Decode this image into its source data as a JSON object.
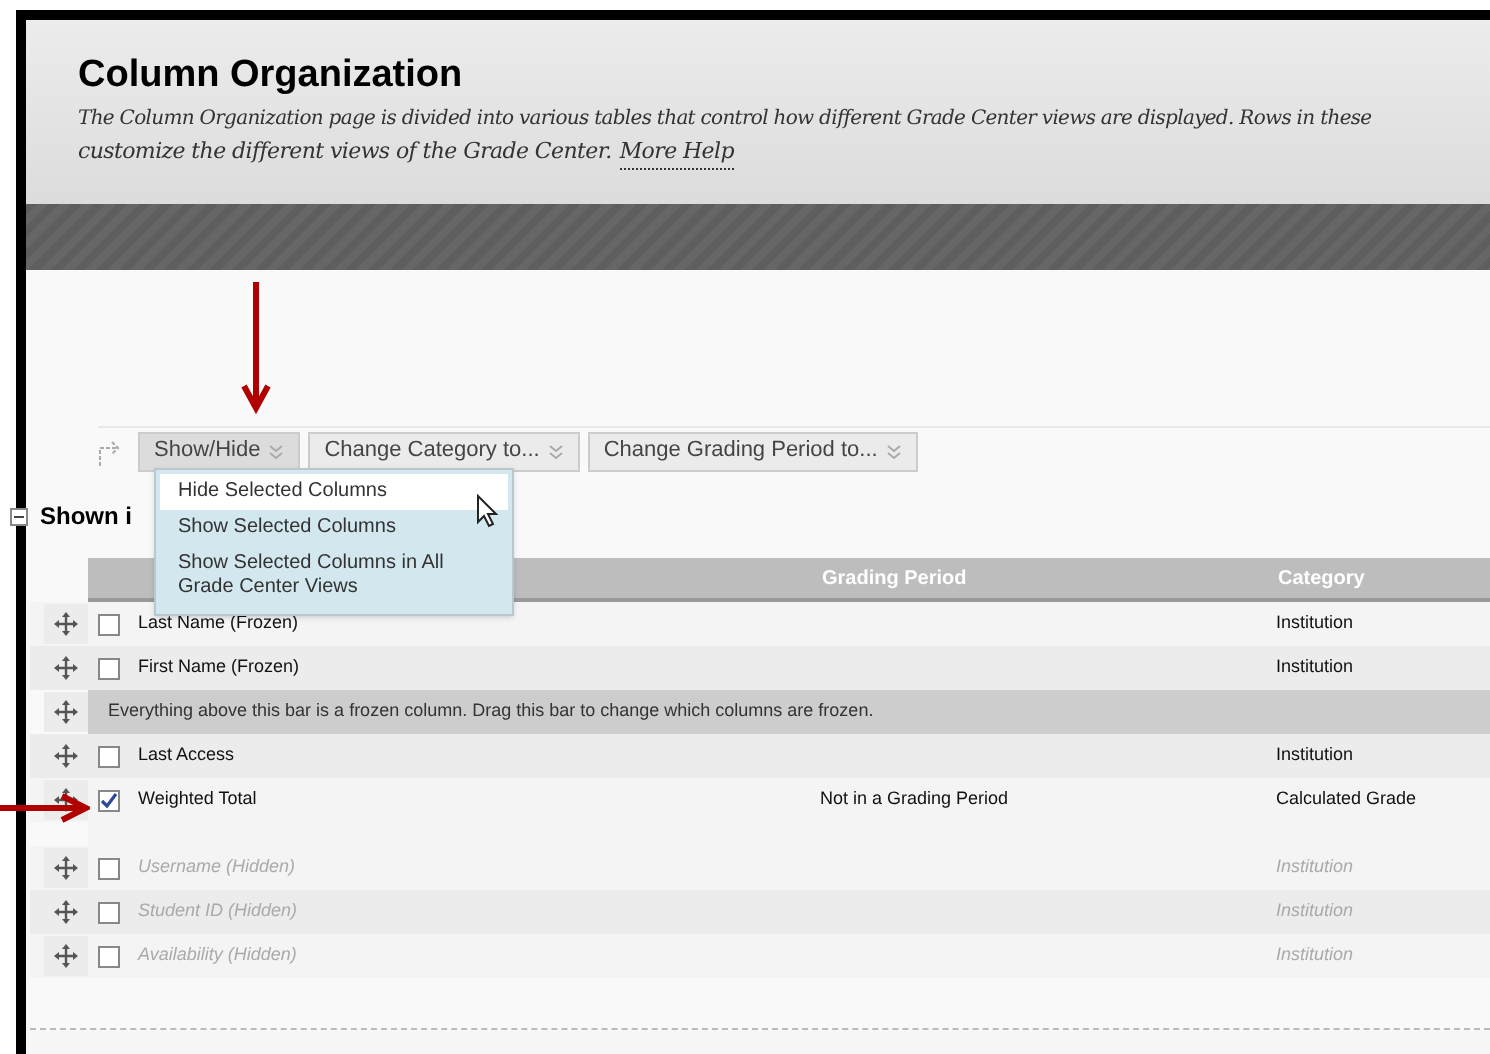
{
  "page": {
    "title": "Column Organization",
    "description": "The Column Organization page is divided into various tables that control how different Grade Center views are displayed. Rows in these",
    "description_2": "customize the different views of the Grade Center.",
    "help_link": "More Help"
  },
  "toolbar": {
    "buttons": [
      {
        "label": "Show/Hide",
        "expanded": true
      },
      {
        "label": "Change Category to...",
        "expanded": false
      },
      {
        "label": "Change Grading Period to...",
        "expanded": false
      }
    ]
  },
  "dropdown": {
    "items": [
      {
        "label": "Hide Selected Columns",
        "selected": true
      },
      {
        "label": "Show Selected Columns",
        "selected": false
      },
      {
        "label": "Show Selected Columns in All Grade Center Views",
        "selected": false
      }
    ]
  },
  "section": {
    "title": "Shown i",
    "expanded": true
  },
  "table": {
    "columns": [
      "Grading Period",
      "Category"
    ],
    "rows": [
      {
        "kind": "column",
        "name": "Last Name (Frozen)",
        "grading_period": "",
        "category": "Institution",
        "checked": false,
        "hidden": false
      },
      {
        "kind": "column",
        "name": "First Name (Frozen)",
        "grading_period": "",
        "category": "Institution",
        "checked": false,
        "hidden": false
      },
      {
        "kind": "divider",
        "name": "Everything above this bar is a frozen column. Drag this bar to change which columns are frozen."
      },
      {
        "kind": "column",
        "name": "Last Access",
        "grading_period": "",
        "category": "Institution",
        "checked": false,
        "hidden": false
      },
      {
        "kind": "column",
        "name": "Weighted Total",
        "grading_period": "Not in a Grading Period",
        "category": "Calculated Grade",
        "checked": true,
        "hidden": false
      },
      {
        "kind": "spacer"
      },
      {
        "kind": "column",
        "name": "Username (Hidden)",
        "grading_period": "",
        "category": "Institution",
        "checked": false,
        "hidden": true
      },
      {
        "kind": "column",
        "name": "Student ID (Hidden)",
        "grading_period": "",
        "category": "Institution",
        "checked": false,
        "hidden": true
      },
      {
        "kind": "column",
        "name": "Availability (Hidden)",
        "grading_period": "",
        "category": "Institution",
        "checked": false,
        "hidden": true
      }
    ]
  }
}
